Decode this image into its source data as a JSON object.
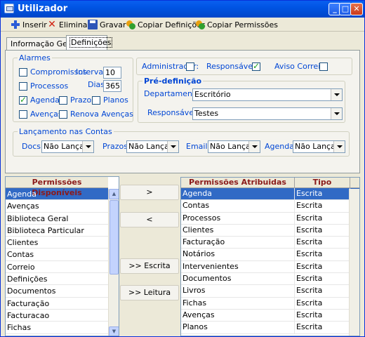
{
  "window": {
    "title": "Utilizador"
  },
  "toolbar": {
    "insert": "Inserir",
    "delete": "Eliminar",
    "save": "Gravar",
    "copy_defs": "Copiar Definições",
    "copy_perms": "Copiar Permissões"
  },
  "tabs": {
    "general": "Informação Geral",
    "definitions": "Definições"
  },
  "alarms": {
    "legend": "Alarmes",
    "compromissos": "Compromissos",
    "processos": "Processos",
    "agenda": "Agenda",
    "prazos": "Prazos",
    "planos": "Planos",
    "avencas": "Avenças",
    "renova_avencas": "Renova Avenças",
    "intervalo_label": "Intervalo:",
    "intervalo_value": "10",
    "dias_label": "Dias:",
    "dias_value": "365",
    "checked": {
      "compromissos": false,
      "processos": false,
      "agenda": true,
      "prazos": false,
      "planos": false,
      "avencas": false,
      "renova_avencas": false
    }
  },
  "flags": {
    "administrador": "Administrador:",
    "responsavel": "Responsável:",
    "aviso_correio": "Aviso Correio:",
    "administrador_checked": false,
    "responsavel_checked": true,
    "aviso_correio_checked": false
  },
  "predef": {
    "legend": "Pré-definição",
    "departamento_label": "Departamento:",
    "departamento_value": "Escritório",
    "responsavel_label": "Responsável:",
    "responsavel_value": "Testes"
  },
  "lancamento": {
    "legend": "Lançamento nas Contas",
    "docs_label": "Docs:",
    "docs_value": "Não Lança",
    "prazos_label": "Prazos:",
    "prazos_value": "Não Lança",
    "emails_label": "Emails:",
    "emails_value": "Não Lança",
    "agenda_label": "Agenda:",
    "agenda_value": "Não Lança"
  },
  "available": {
    "header": "Permissões Disponíveis",
    "items": [
      "Agenda",
      "Avenças",
      "Biblioteca Geral",
      "Biblioteca Particular",
      "Clientes",
      "Contas",
      "Correio",
      "Definições",
      "Documentos",
      "Facturação",
      "Facturacao",
      "Fichas"
    ],
    "selected": 0
  },
  "buttons": {
    "add": ">",
    "remove": "<",
    "escrita": ">> Escrita",
    "leitura": ">> Leitura"
  },
  "assigned": {
    "header_perm": "Permissões Atribuidas",
    "header_tipo": "Tipo",
    "selected": 0,
    "rows": [
      {
        "perm": "Agenda",
        "tipo": "Escrita"
      },
      {
        "perm": "Contas",
        "tipo": "Escrita"
      },
      {
        "perm": "Processos",
        "tipo": "Escrita"
      },
      {
        "perm": "Clientes",
        "tipo": "Escrita"
      },
      {
        "perm": "Facturação",
        "tipo": "Escrita"
      },
      {
        "perm": "Notários",
        "tipo": "Escrita"
      },
      {
        "perm": "Intervenientes",
        "tipo": "Escrita"
      },
      {
        "perm": "Documentos",
        "tipo": "Escrita"
      },
      {
        "perm": "Livros",
        "tipo": "Escrita"
      },
      {
        "perm": "Fichas",
        "tipo": "Escrita"
      },
      {
        "perm": "Avenças",
        "tipo": "Escrita"
      },
      {
        "perm": "Planos",
        "tipo": "Escrita"
      }
    ]
  }
}
